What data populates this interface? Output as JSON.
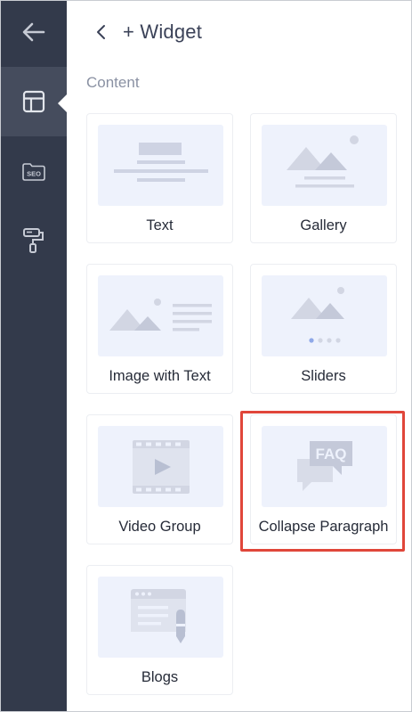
{
  "header": {
    "title": "+ Widget"
  },
  "section": {
    "title": "Content"
  },
  "widgets": [
    {
      "label": "Text"
    },
    {
      "label": "Gallery"
    },
    {
      "label": "Image with Text"
    },
    {
      "label": "Sliders"
    },
    {
      "label": "Video Group"
    },
    {
      "label": "Collapse Paragraph",
      "highlighted": true
    },
    {
      "label": "Blogs"
    }
  ],
  "sidebar": {
    "items": [
      {
        "icon": "arrow-left-icon"
      },
      {
        "icon": "layout-icon",
        "active": true
      },
      {
        "icon": "seo-icon",
        "text": "SEO"
      },
      {
        "icon": "paint-roller-icon"
      }
    ]
  },
  "icons": {
    "faq_text": "FAQ"
  },
  "colors": {
    "sidebar_bg": "#333a4b",
    "sidebar_active": "#454c5d",
    "thumb_bg": "#eef2fc",
    "highlight": "#e0463a"
  }
}
